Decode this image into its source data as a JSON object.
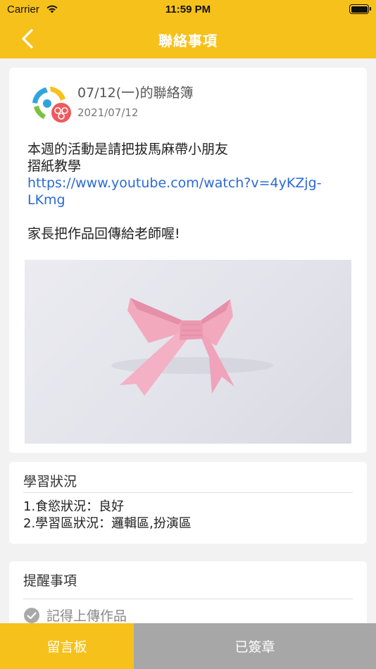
{
  "status_bar": {
    "carrier": "Carrier",
    "time": "11:59 PM"
  },
  "nav": {
    "title": "聯絡事項",
    "back_icon": "chevron-left-icon"
  },
  "post": {
    "title": "07/12(一)的聯絡簿",
    "date": "2021/07/12",
    "body_line1": "本週的活動是請把拔馬麻帶小朋友",
    "body_line2": "摺紙教學",
    "link_line1": "https://www.youtube.com/watch?v=4yKZjg-",
    "link_line2": "LKmg",
    "body_line3": "家長把作品回傳給老師喔!"
  },
  "learning": {
    "heading": "學習狀況",
    "line1": "1.食慾狀況：良好",
    "line2": "2.學習區狀況：邏輯區,扮演區"
  },
  "reminders": {
    "heading": "提醒事項",
    "items": [
      {
        "label": "記得上傳作品",
        "icon": "check-circle-icon"
      }
    ]
  },
  "bottom": {
    "board_label": "留言板",
    "signed_label": "已簽章"
  },
  "colors": {
    "accent": "#f7c11b",
    "link": "#2a6ad6",
    "signed_bg": "#a7a7a7",
    "ribbon": "#f2a9be"
  }
}
